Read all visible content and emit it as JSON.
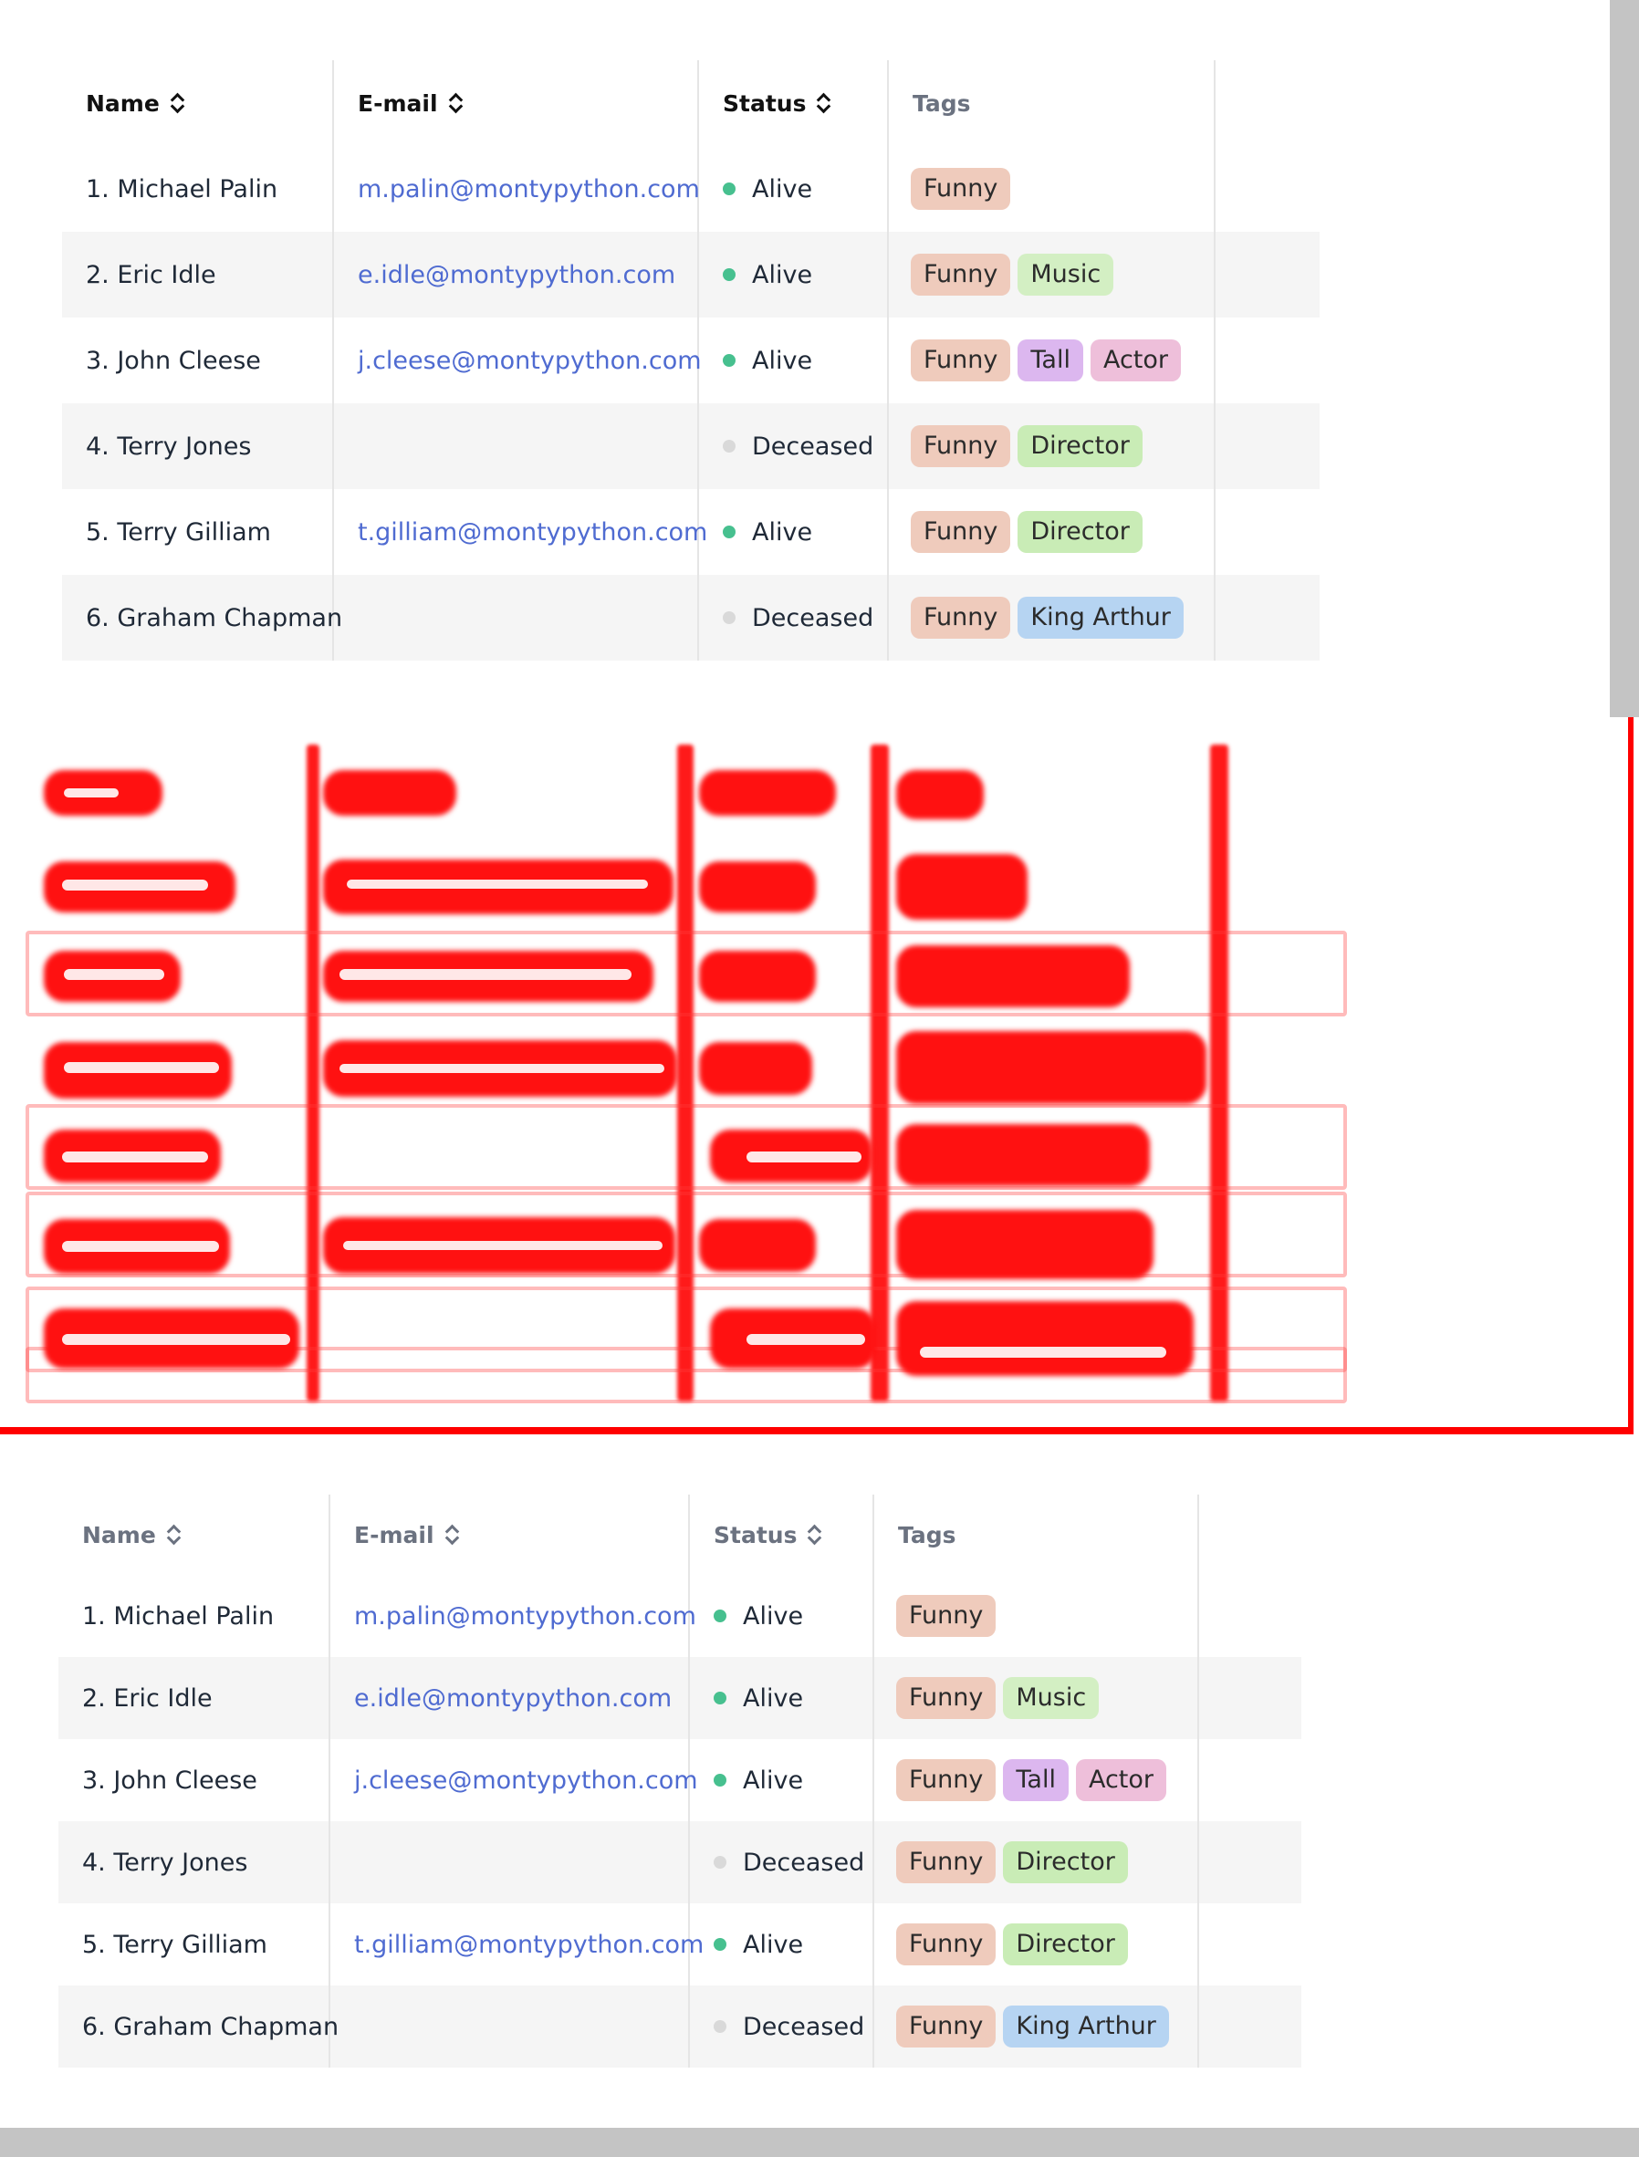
{
  "columns": {
    "name": "Name",
    "email": "E-mail",
    "status": "Status",
    "tags": "Tags"
  },
  "colors": {
    "alive": "#47c08f",
    "deceased": "#d9d9d9",
    "Funny": "#efcbbc",
    "Music": "#d3efc3",
    "Tall": "#dcb7ef",
    "Actor": "#eebfda",
    "Director": "#c9ecb6",
    "King Arthur": "#b6d4f2",
    "heatmap": "#ff0000"
  },
  "rows": [
    {
      "name": "1. Michael Palin",
      "email": "m.palin@montypython.com",
      "status": "Alive",
      "tags": [
        "Funny"
      ]
    },
    {
      "name": "2. Eric Idle",
      "email": "e.idle@montypython.com",
      "status": "Alive",
      "tags": [
        "Funny",
        "Music"
      ]
    },
    {
      "name": "3. John Cleese",
      "email": "j.cleese@montypython.com",
      "status": "Alive",
      "tags": [
        "Funny",
        "Tall",
        "Actor"
      ]
    },
    {
      "name": "4. Terry Jones",
      "email": "",
      "status": "Deceased",
      "tags": [
        "Funny",
        "Director"
      ]
    },
    {
      "name": "5. Terry Gilliam",
      "email": "t.gilliam@montypython.com",
      "status": "Alive",
      "tags": [
        "Funny",
        "Director"
      ]
    },
    {
      "name": "6. Graham Chapman",
      "email": "",
      "status": "Deceased",
      "tags": [
        "Funny",
        "King Arthur"
      ]
    }
  ]
}
